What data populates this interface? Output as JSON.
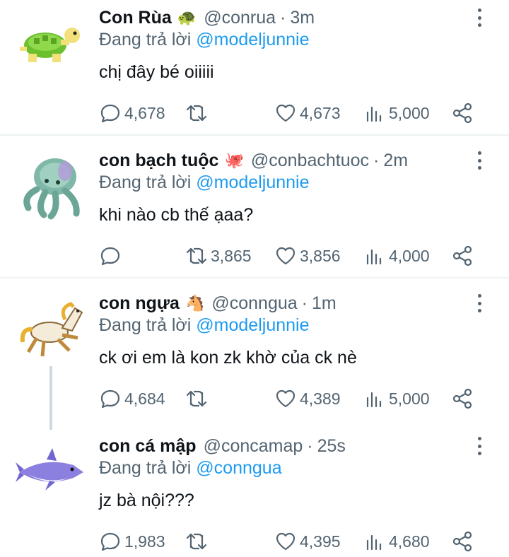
{
  "tweets": [
    {
      "name": "Con Rùa",
      "emoji": "🐢",
      "handle": "@conrua",
      "time": "3m",
      "reply_prefix": "Đang trả lời",
      "reply_to": "@modeljunnie",
      "text": "chị đây bé oiiiii",
      "replies": "4,678",
      "retweets": "",
      "likes": "4,673",
      "views": "5,000",
      "avatar_icon": "turtle-icon"
    },
    {
      "name": "con bạch tuộc",
      "emoji": "🐙",
      "handle": "@conbachtuoc",
      "time": "2m",
      "reply_prefix": "Đang trả lời",
      "reply_to": "@modeljunnie",
      "text": "khi nào cb thế ạaa?",
      "replies": "",
      "retweets": "3,865",
      "likes": "3,856",
      "views": "4,000",
      "avatar_icon": "octopus-icon"
    },
    {
      "name": "con ngựa",
      "emoji": "🐴",
      "handle": "@conngua",
      "time": "1m",
      "reply_prefix": "Đang trả lời",
      "reply_to": "@modeljunnie",
      "text": "ck ơi em là kon zk khờ của ck nè",
      "replies": "4,684",
      "retweets": "",
      "likes": "4,389",
      "views": "5,000",
      "avatar_icon": "horse-icon"
    },
    {
      "name": "con cá mập",
      "emoji": "",
      "handle": "@concamap",
      "time": "25s",
      "reply_prefix": "Đang trả lời",
      "reply_to": "@conngua",
      "text": "jz bà nội???",
      "replies": "1,983",
      "retweets": "",
      "likes": "4,395",
      "views": "4,680",
      "avatar_icon": "shark-icon"
    }
  ],
  "colors": {
    "text": "#0f1419",
    "secondary": "#536471",
    "link": "#1d9bf0",
    "divider": "#eff3f4"
  }
}
